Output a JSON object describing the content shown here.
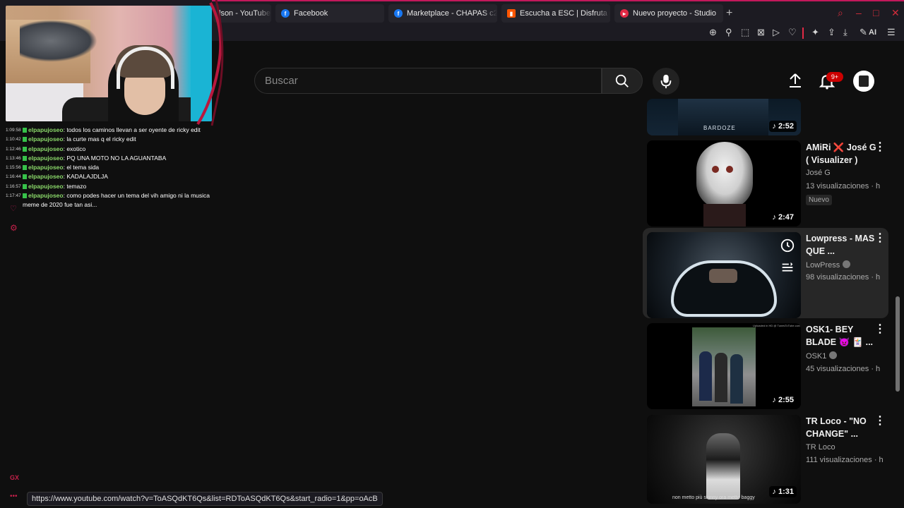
{
  "browser": {
    "tabs": [
      {
        "label": "lson - YouTube",
        "icon": "youtube-icon",
        "color": "#ff0000"
      },
      {
        "label": "Facebook",
        "icon": "facebook-icon",
        "color": "#1877f2"
      },
      {
        "label": "Marketplace - CHAPAS c2",
        "icon": "facebook-icon",
        "color": "#1877f2"
      },
      {
        "label": "Escucha a ESC | Disfruta d",
        "icon": "soundcloud-icon",
        "color": "#ff5500"
      },
      {
        "label": "Nuevo proyecto - Studio",
        "icon": "studio-icon",
        "color": "#e22a45"
      }
    ],
    "new_tab_symbol": "+",
    "ai_label": "AI",
    "accent": "#e22a45"
  },
  "chat": {
    "messages": [
      {
        "time": "1:09:58",
        "user": "elpapujoseo",
        "text": "todos los caminos llevan a ser oyente de ricky edit"
      },
      {
        "time": "1:10:42",
        "user": "elpapujoseo",
        "text": "la curte mas q el ricky edit"
      },
      {
        "time": "1:12:46",
        "user": "elpapujoseo",
        "text": "exotico"
      },
      {
        "time": "1:13:46",
        "user": "elpapujoseo",
        "text": "PQ UNA MOTO NO LA AGUANTABA"
      },
      {
        "time": "1:15:56",
        "user": "elpapujoseo",
        "text": "el tema sida"
      },
      {
        "time": "1:16:44",
        "user": "elpapujoseo",
        "text": "KADALAJDLJA"
      },
      {
        "time": "1:16:57",
        "user": "elpapujoseo",
        "text": "temazo"
      },
      {
        "time": "1:17:47",
        "user": "elpapujoseo",
        "text": "como podes hacer un tema del vih amigo ni la musica meme de 2020 fue tan asi..."
      }
    ],
    "logo_text": "GX",
    "dots": "•••"
  },
  "youtube": {
    "search_placeholder": "Buscar",
    "notification_count": "9+",
    "videos": [
      {
        "title": "",
        "channel": "",
        "views": "",
        "duration": "2:52",
        "thumb_text": "BARDOZE"
      },
      {
        "title": "AMiRi ❌ José G ( Visualizer )",
        "channel": "José G",
        "views": "13 visualizaciones · h",
        "duration": "2:47",
        "badge": "Nuevo"
      },
      {
        "title": "Lowpress - MAS QUE ...",
        "channel": "LowPress",
        "views": "98 visualizaciones · h",
        "duration": ""
      },
      {
        "title": "OSK1- BEY BLADE 👿 🃏 ...",
        "channel": "OSK1",
        "views": "45 visualizaciones · h",
        "duration": "2:55",
        "thumb_text": "Uploaded in HD @ TunesToTube.com"
      },
      {
        "title": "TR Loco - \"NO CHANGE\" ...",
        "channel": "TR Loco",
        "views": "111 visualizaciones · h",
        "duration": "1:31",
        "thumb_text": "non metto più skinny ora metto baggy"
      }
    ]
  },
  "status_url": "https://www.youtube.com/watch?v=ToASQdKT6Qs&list=RDToASQdKT6Qs&start_radio=1&pp=oAcB"
}
